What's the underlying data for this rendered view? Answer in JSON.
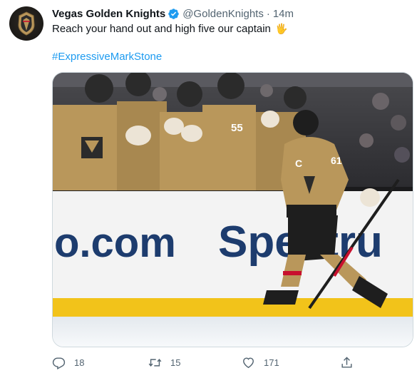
{
  "tweet": {
    "author": {
      "display_name": "Vegas Golden Knights",
      "handle": "@GoldenKnights",
      "verified": true,
      "avatar_icon": "golden-knights-helmet-logo"
    },
    "separator": "·",
    "timestamp": "14m",
    "text": "Reach your hand out and high five our captain",
    "emoji": "🖐",
    "hashtag": "#ExpressiveMarkStone",
    "media": {
      "board_text_left": "o.com",
      "board_text_right": "Spectru",
      "jersey_number": "61",
      "bench_jersey_number": "55",
      "captain_letter": "C"
    },
    "actions": {
      "reply_count": "18",
      "retweet_count": "15",
      "like_count": "171"
    }
  },
  "colors": {
    "text": "#0f1419",
    "secondary": "#536471",
    "link": "#1d9bf0",
    "verified": "#1d9bf0",
    "jersey_gold": "#b9975b",
    "board_blue": "#1d3c6e",
    "board_yellow": "#f2c31a"
  }
}
